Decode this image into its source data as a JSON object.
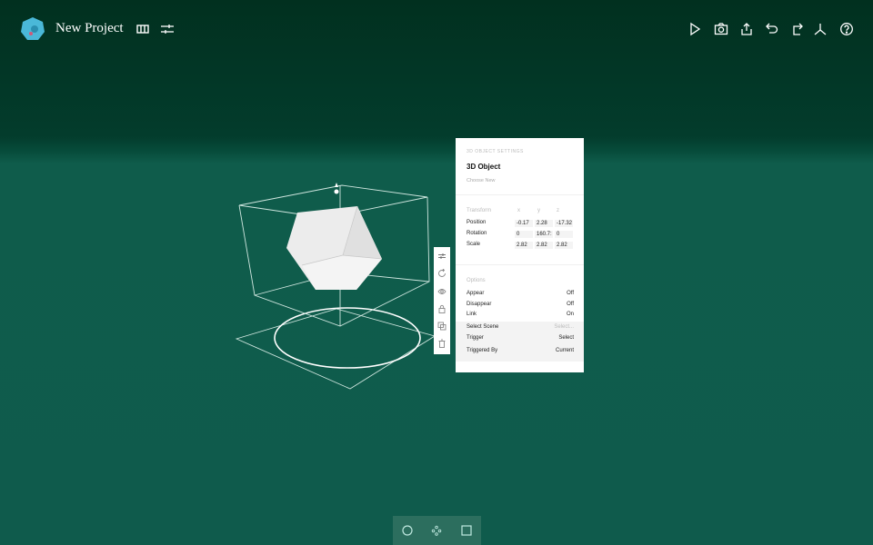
{
  "header": {
    "title": "New Project",
    "icons_left": [
      "layout-icon",
      "sliders-icon"
    ],
    "icons_right": [
      "play-icon",
      "camera-icon",
      "share-icon",
      "undo-icon",
      "redo-icon",
      "axes-icon",
      "help-icon"
    ]
  },
  "panel": {
    "header": "3D OBJECT SETTINGS",
    "title": "3D Object",
    "choose": "Choose New",
    "transform": {
      "label": "Transform",
      "axes": [
        "x",
        "y",
        "z"
      ],
      "rows": [
        {
          "label": "Position",
          "values": [
            "-0.17",
            "2.28",
            "-17.32"
          ]
        },
        {
          "label": "Rotation",
          "values": [
            "0",
            "160.7:",
            "0"
          ]
        },
        {
          "label": "Scale",
          "values": [
            "2.82",
            "2.82",
            "2.82"
          ]
        }
      ]
    },
    "options": {
      "label": "Options",
      "rows": [
        {
          "label": "Appear",
          "value": "Off"
        },
        {
          "label": "Disappear",
          "value": "Off"
        },
        {
          "label": "Link",
          "value": "On"
        },
        {
          "label": "Select Scene",
          "value": "Select..."
        },
        {
          "label": "Trigger",
          "value": "Select"
        },
        {
          "label": "Triggered By",
          "value": "Current"
        }
      ]
    }
  },
  "side_toolbar": [
    "sliders-icon",
    "rotate-icon",
    "eye-icon",
    "lock-icon",
    "duplicate-icon",
    "trash-icon"
  ],
  "bottom_toolbar": [
    "circle-icon",
    "dots-icon",
    "square-icon"
  ],
  "colors": {
    "floor": "#0f5b4c",
    "sky": "#01301f",
    "accent": "#4ab8d8"
  }
}
